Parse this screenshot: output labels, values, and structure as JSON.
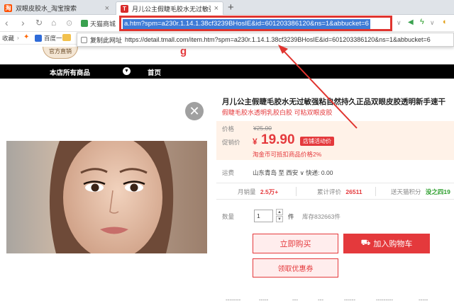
{
  "browser": {
    "tabs": [
      {
        "title": "双眼皮胶水_淘宝搜索",
        "favicon": "淘",
        "favicon_color": "#ff5000",
        "active": false
      },
      {
        "title": "月儿公主假睫毛胶水无过敏强粘",
        "favicon": "T",
        "favicon_color": "#d92b2b",
        "active": true
      }
    ],
    "new_tab": "+",
    "bookmark_chip_label": "天猫商城",
    "url_text": "a.htm?spm=a230r.1.14.1.38cf3239BHosIE&id=601203386120&ns=1&abbucket=6",
    "bookmarks": [
      "收藏",
      "百度一下"
    ],
    "copy_popup": {
      "label": "复制此网址",
      "url": "https://detail.tmall.com/item.htm?spm=a230r.1.14.1.38cf3239BHosIE&id=601203386120&ns=1&abbucket=6"
    }
  },
  "shop": {
    "logo_text": "官方直销",
    "nav": [
      "本店所有商品",
      "首页"
    ]
  },
  "product": {
    "title": "月儿公主假睫毛胶水无过敏强粘自然持久正品双眼皮胶透明新手速干",
    "subtitle": "假睫毛胶水透明乳胶白胶 可粘双眼皮胶",
    "price_label": "价格",
    "original_price": "¥25.00",
    "promo_label": "促销价",
    "currency": "¥",
    "promo_price": "19.90",
    "promo_badge": "店铺活动价",
    "promo_note": "淘金币可抵扣商品价格2%",
    "shipping_label": "运费",
    "shipping_value": "山东青岛 至 西安 ∨ 快递: 0.00",
    "stats": [
      {
        "label": "月销量",
        "value": "2.5万+"
      },
      {
        "label": "累计评价",
        "value": "26511"
      },
      {
        "label": "送天猫积分",
        "value": "没之四19"
      }
    ],
    "quantity_label": "数量",
    "quantity_value": "1",
    "quantity_unit": "件",
    "stock": "库存832663件",
    "buy_now": "立即购买",
    "add_to_cart": "加入购物车",
    "coupon": "领取优惠券",
    "bottom_tabs": [
      "--------",
      "-----",
      "---",
      "---",
      "------",
      "---------",
      "-----"
    ]
  },
  "colors": {
    "accent_red": "#e4393c",
    "url_highlight": "#3e7bd6",
    "annotation_red": "#e0342f"
  }
}
